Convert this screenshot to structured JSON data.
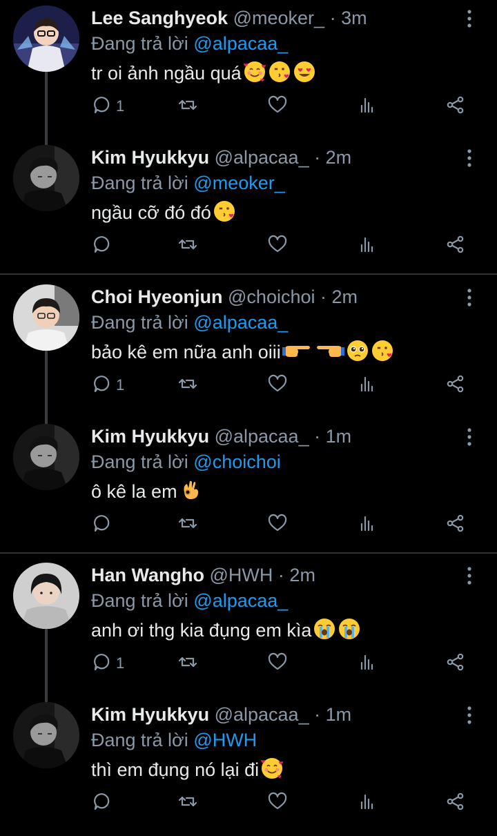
{
  "reply_prefix": "Đang trả lời",
  "threads": [
    {
      "tweets": [
        {
          "name": "Lee Sanghyeok",
          "handle": "@meoker_",
          "time": "3m",
          "reply_to": "@alpacaa_",
          "text": " tr oi ảnh ngầu quá",
          "emojis": [
            "smiling-face-with-hearts",
            "kissing-heart",
            "heart-eyes"
          ],
          "reply_count": "1",
          "avatar": "lee"
        },
        {
          "name": "Kim Hyukkyu",
          "handle": "@alpacaa_",
          "time": "2m",
          "reply_to": "@meoker_",
          "text": "ngầu cỡ đó đó",
          "emojis": [
            "kissing-heart"
          ],
          "reply_count": "",
          "avatar": "kim"
        }
      ]
    },
    {
      "tweets": [
        {
          "name": "Choi Hyeonjun",
          "handle": "@choichoi",
          "time": "2m",
          "reply_to": "@alpacaa_",
          "text": "bảo kê em nữa anh oiii",
          "emojis": [
            "point-right",
            "point-left",
            "pleading-face",
            "kissing-heart"
          ],
          "reply_count": "1",
          "avatar": "choi"
        },
        {
          "name": "Kim Hyukkyu",
          "handle": "@alpacaa_",
          "time": "1m",
          "reply_to": "@choichoi",
          "text": "ô kê la em",
          "emojis": [
            "ok-hand"
          ],
          "reply_count": "",
          "avatar": "kim"
        }
      ]
    },
    {
      "tweets": [
        {
          "name": "Han Wangho",
          "handle": "@HWH",
          "time": "2m",
          "reply_to": "@alpacaa_",
          "text": "anh ơi thg kia đụng em kìa",
          "emojis": [
            "loudly-crying",
            "loudly-crying"
          ],
          "reply_count": "1",
          "avatar": "han"
        },
        {
          "name": "Kim Hyukkyu",
          "handle": "@alpacaa_",
          "time": "1m",
          "reply_to": "@HWH",
          "text": "thì em đụng nó lại đi",
          "emojis": [
            "smiling-face-with-hearts"
          ],
          "reply_count": "",
          "avatar": "kim"
        }
      ]
    }
  ],
  "colors": {
    "background": "#000000",
    "mention": "#1d9bf0",
    "muted": "#8b98a5",
    "text": "#e7e9ea"
  }
}
